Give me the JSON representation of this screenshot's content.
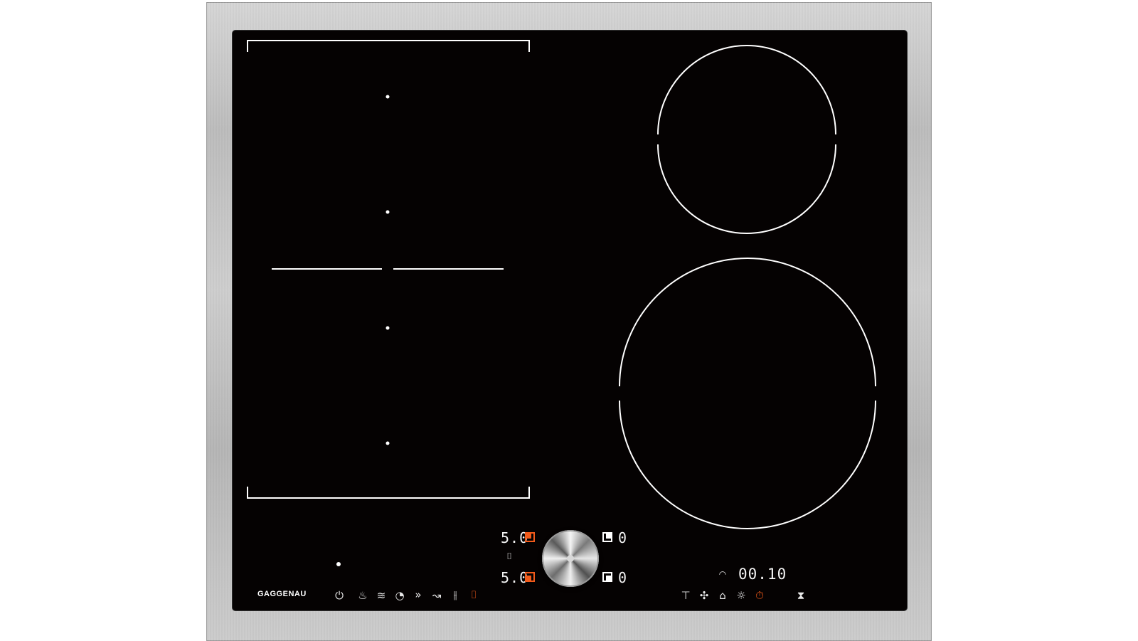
{
  "brand": "GAGGENAU",
  "colors": {
    "accent": "#f15a1a",
    "glass": "#050202",
    "frame": "stainless-steel"
  },
  "controls": {
    "zone_front_left": {
      "power": "5.0"
    },
    "zone_rear_left": {
      "power": "5.0"
    },
    "zone_rear_right": {
      "power": "0"
    },
    "zone_front_right": {
      "power": "0"
    },
    "timer": {
      "value": "00.10"
    }
  },
  "left_icons": [
    {
      "name": "power-icon",
      "glyph": "⏻"
    },
    {
      "name": "cooking-sensor-icon",
      "glyph": "♨"
    },
    {
      "name": "frying-sensor-icon",
      "glyph": "≋"
    },
    {
      "name": "keep-warm-icon",
      "glyph": "◔"
    },
    {
      "name": "boost-icon",
      "glyph": "»"
    },
    {
      "name": "simmer-icon",
      "glyph": "↝"
    },
    {
      "name": "steam-icon",
      "glyph": "⫲"
    },
    {
      "name": "flex-zone-icon",
      "glyph": "⌷"
    }
  ],
  "right_icons": [
    {
      "name": "wipe-protection-icon",
      "glyph": "⊤"
    },
    {
      "name": "fan-icon",
      "glyph": "✣"
    },
    {
      "name": "hood-connection-icon",
      "glyph": "⌂"
    },
    {
      "name": "light-icon",
      "glyph": "☼"
    },
    {
      "name": "stopwatch-icon",
      "glyph": "⏱"
    },
    {
      "name": "hourglass-icon",
      "glyph": "⧗"
    }
  ]
}
